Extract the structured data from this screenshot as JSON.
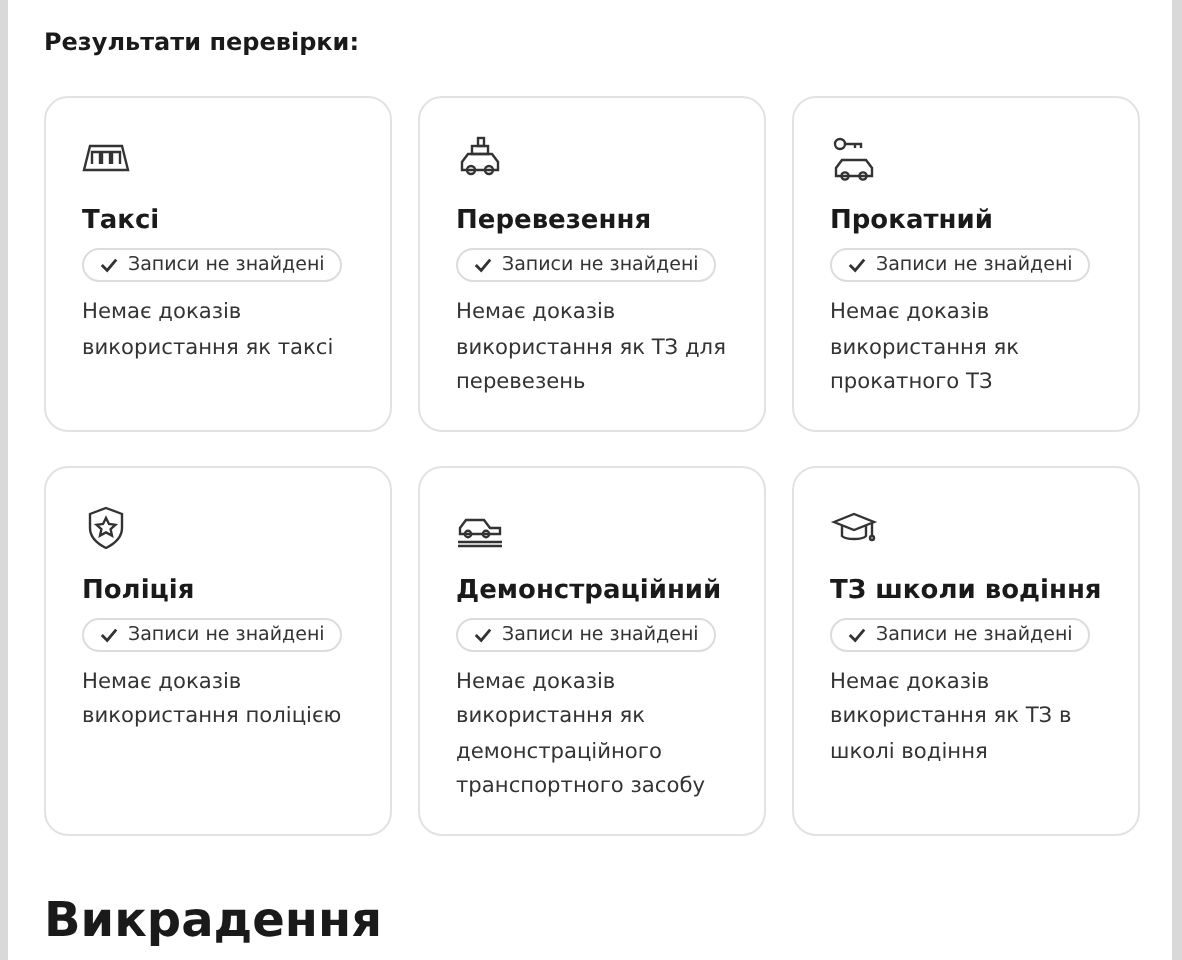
{
  "section_title": "Результати перевірки:",
  "cards": [
    {
      "title": "Таксі",
      "badge": "Записи не знайдені",
      "description": "Немає доказів використання як таксі"
    },
    {
      "title": "Перевезення",
      "badge": "Записи не знайдені",
      "description": "Немає доказів використання як ТЗ для перевезень"
    },
    {
      "title": "Прокатний",
      "badge": "Записи не знайдені",
      "description": "Немає доказів використання як прокатного ТЗ"
    },
    {
      "title": "Поліція",
      "badge": "Записи не знайдені",
      "description": "Немає доказів використання поліцією"
    },
    {
      "title": "Демонстраційний",
      "badge": "Записи не знайдені",
      "description": "Немає доказів використання як демонстраційного транспортного засобу"
    },
    {
      "title": "ТЗ школи водіння",
      "badge": "Записи не знайдені",
      "description": "Немає доказів використання як ТЗ в школі водіння"
    }
  ],
  "next_heading": "Викрадення"
}
